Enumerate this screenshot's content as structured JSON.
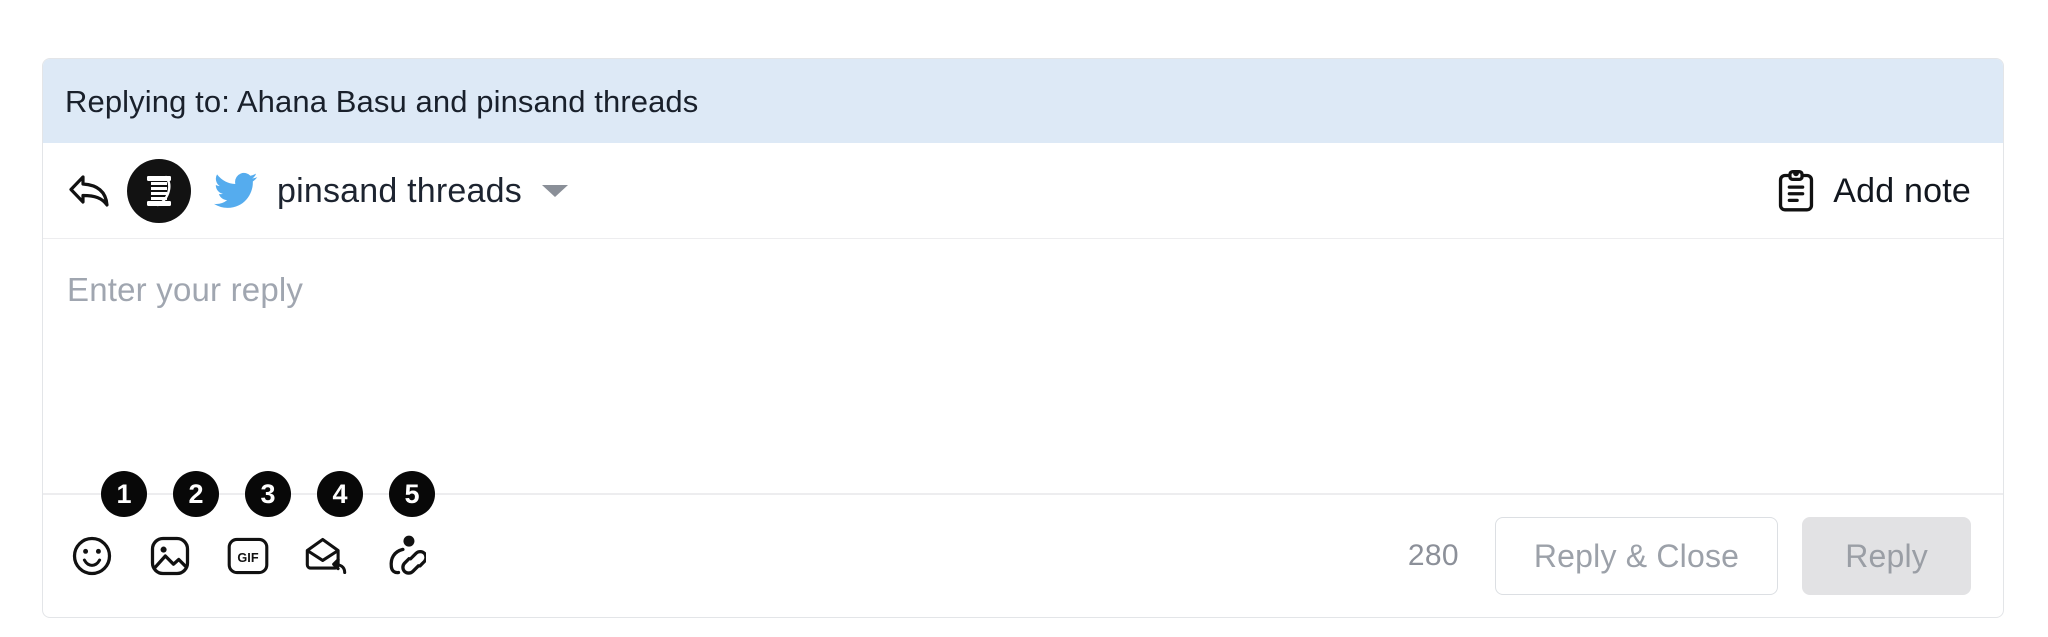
{
  "banner": {
    "text": "Replying to: Ahana Basu and pinsand threads"
  },
  "account_row": {
    "reply_arrow_icon": "reply-arrow-icon",
    "avatar_icon": "thread-spool-avatar",
    "channel_icon": "twitter-bird-icon",
    "account_name": "pinsand threads",
    "chevron_icon": "chevron-down-icon",
    "add_note": {
      "icon": "clipboard-note-icon",
      "label": "Add note"
    }
  },
  "reply_input": {
    "placeholder": "Enter your reply",
    "value": ""
  },
  "step_badges": [
    {
      "label": "1"
    },
    {
      "label": "2"
    },
    {
      "label": "3"
    },
    {
      "label": "4"
    },
    {
      "label": "5"
    }
  ],
  "toolbar": {
    "icons": [
      {
        "name": "emoji-icon"
      },
      {
        "name": "image-icon"
      },
      {
        "name": "gif-icon",
        "label": "GIF"
      },
      {
        "name": "saved-reply-icon"
      },
      {
        "name": "person-link-icon"
      }
    ],
    "char_count": "280",
    "reply_close_label": "Reply & Close",
    "reply_label": "Reply"
  },
  "colors": {
    "banner_bg": "#dde9f6",
    "twitter_blue": "#55acee",
    "badge_bg": "#080808",
    "card_border": "#e3e5e8",
    "placeholder": "#a0a6b0",
    "disabled_btn_bg": "#e2e2e4"
  }
}
